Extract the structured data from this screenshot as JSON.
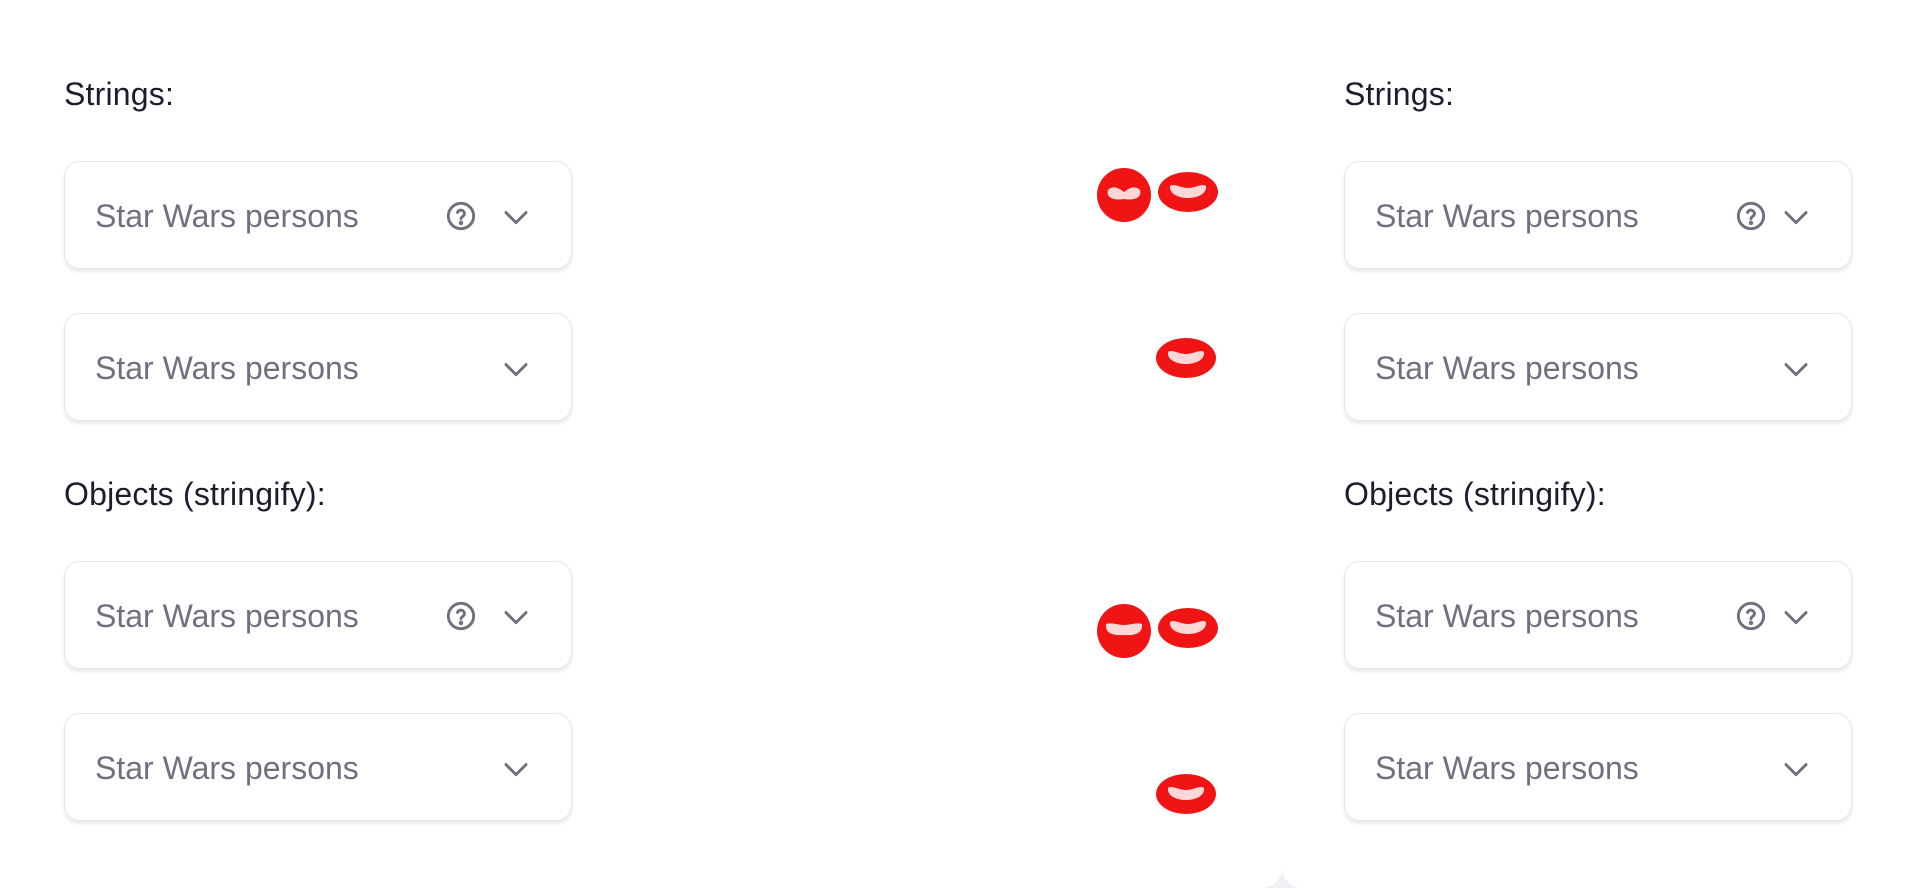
{
  "colors": {
    "heading_text": "#1b1d2e",
    "field_text": "#6e7080",
    "icon": "#6e7080",
    "indicator_red": "#f01414",
    "background": "#eef0f4",
    "panel": "#ffffff"
  },
  "panels": {
    "left": {
      "strings_heading": "Strings:",
      "objects_heading": "Objects (stringify):",
      "strings_select_1": {
        "value": "Star Wars persons",
        "icons": [
          "help-circle-icon",
          "chevron-down-icon"
        ]
      },
      "strings_select_2": {
        "value": "Star Wars persons",
        "icons": [
          "chevron-down-icon"
        ]
      },
      "objects_select_1": {
        "value": "Star Wars persons",
        "icons": [
          "help-circle-icon",
          "chevron-down-icon"
        ]
      },
      "objects_select_2": {
        "value": "Star Wars persons",
        "icons": [
          "chevron-down-icon"
        ]
      }
    },
    "right": {
      "strings_heading": "Strings:",
      "objects_heading": "Objects (stringify):",
      "strings_select_1": {
        "value": "Star Wars persons",
        "icons": [
          "help-circle-icon",
          "chevron-down-icon"
        ]
      },
      "strings_select_2": {
        "value": "Star Wars persons",
        "icons": [
          "chevron-down-icon"
        ]
      },
      "objects_select_1": {
        "value": "Star Wars persons",
        "icons": [
          "help-circle-icon",
          "chevron-down-icon"
        ]
      },
      "objects_select_2": {
        "value": "Star Wars persons",
        "icons": [
          "chevron-down-icon"
        ]
      }
    }
  }
}
